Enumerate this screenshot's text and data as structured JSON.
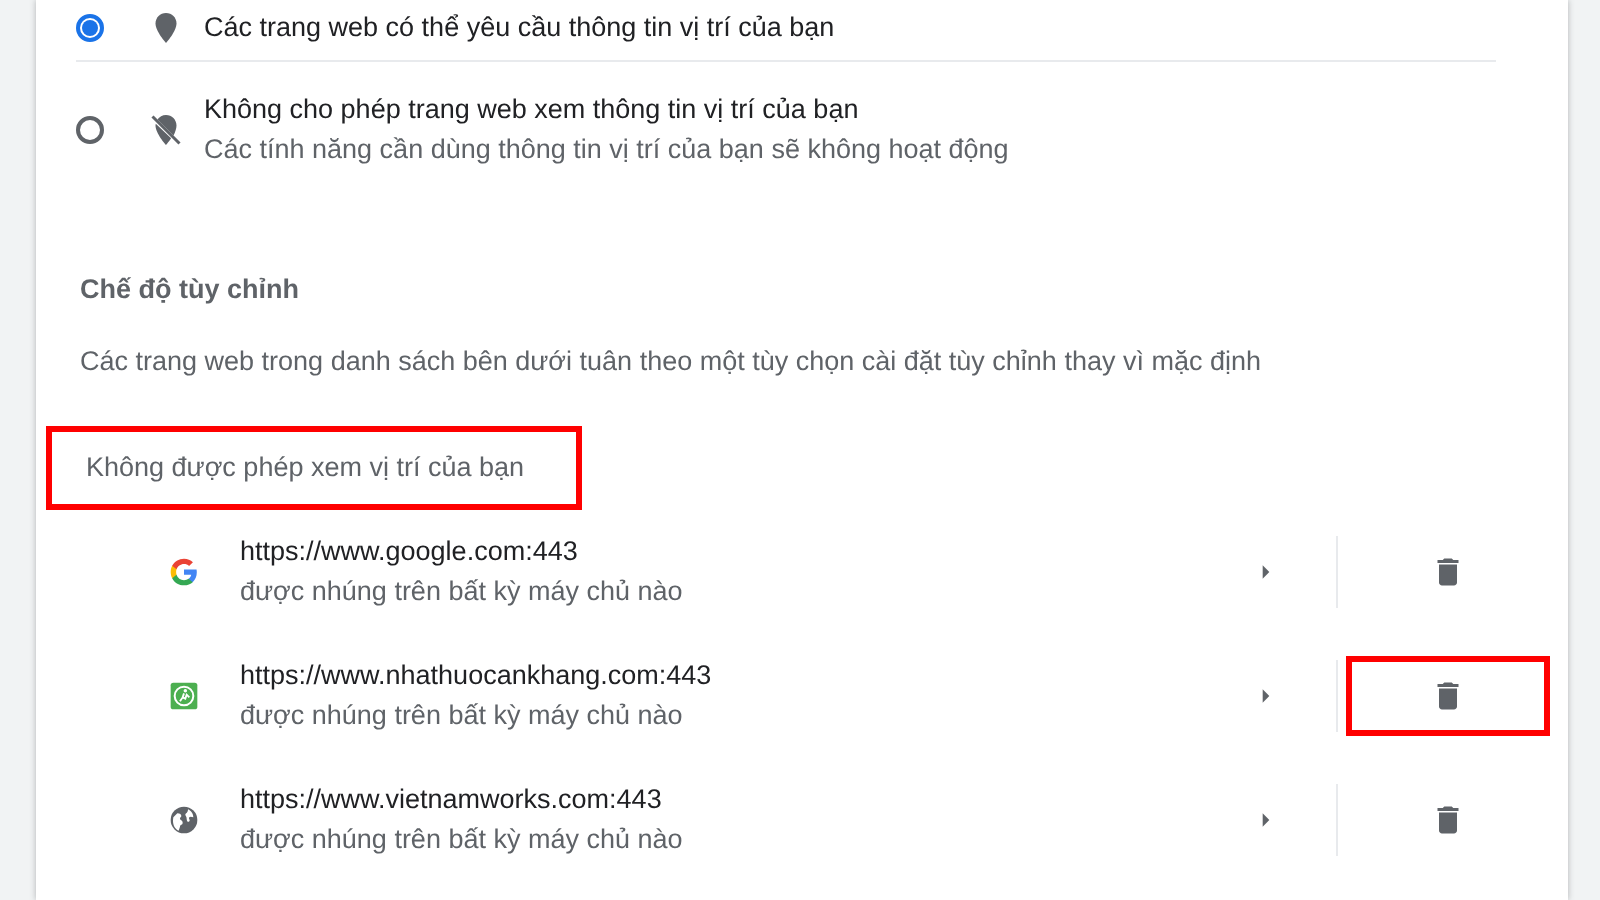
{
  "location_options": [
    {
      "kind": "radio",
      "selected": true,
      "title": "Các trang web có thể yêu cầu thông tin vị trí của bạn"
    },
    {
      "kind": "radio",
      "selected": false,
      "title": "Không cho phép trang web xem thông tin vị trí của bạn",
      "subtitle": "Các tính năng cần dùng thông tin vị trí của bạn sẽ không hoạt động"
    }
  ],
  "custom_section": {
    "title": "Chế độ tùy chỉnh",
    "description": "Các trang web trong danh sách bên dưới tuân theo một tùy chọn cài đặt tùy chỉnh thay vì mặc định"
  },
  "blocked_list": {
    "heading": "Không được phép xem vị trí của bạn",
    "highlighted": true,
    "sites": [
      {
        "url": "https://www.google.com:443",
        "subtitle": "được nhúng trên bất kỳ máy chủ nào",
        "delete_highlighted": false
      },
      {
        "url": "https://www.nhathuocankhang.com:443",
        "subtitle": "được nhúng trên bất kỳ máy chủ nào",
        "delete_highlighted": true
      },
      {
        "url": "https://www.vietnamworks.com:443",
        "subtitle": "được nhúng trên bất kỳ máy chủ nào",
        "delete_highlighted": false
      }
    ]
  }
}
